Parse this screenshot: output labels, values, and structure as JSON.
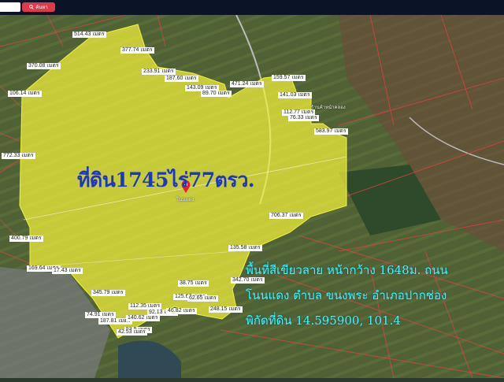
{
  "search": {
    "placeholder": "",
    "button_label": "ค้นหา"
  },
  "main_title": "ที่ดิน1745ไร่77ตรว.",
  "info_lines": [
    "พื้นที่สีเขียวลาย หน้ากว้าง 1648ม. ถนน",
    "โนนแดง ตำบล ขนงพระ อำเภอปากช่อง",
    "พิกัดที่ดิน 14.595900, 101.4"
  ],
  "distance_labels": [
    "514.43 เมตร",
    "377.74 เมตร",
    "370.08 เมตร",
    "233.91 เมตร",
    "187.60 เมตร",
    "143.09 เมตร",
    "89.70 เมตร",
    "471.24 เมตร",
    "159.57 เมตร",
    "106.14 เมตร",
    "141.03 เมตร",
    "112.77 เมตร",
    "76.33 เมตร",
    "583.97 เมตร",
    "772.33 เมตร",
    "706.37 เมตร",
    "400.79 เมตร",
    "135.58 เมตร",
    "169.64 เมตร",
    "17.43 เมตร",
    "342.70 เมตร",
    "345.79 เมตร",
    "38.75 เมตร",
    "125.67 เมตร",
    "62.65 เมตร",
    "112.35 เมตร",
    "248.15 เมตร",
    "74.91 เมตร",
    "187.81 เมตร",
    "92.13 เมตร",
    "140.62 เมตร",
    "46.82 เมตร",
    "53.5 เมตร",
    "42.53 เมตร"
  ],
  "poi_labels": [
    "โนนแดง",
    "ร้านค้าหน้าคลอง"
  ],
  "colors": {
    "parcel_fill": "#f4f23c",
    "title_text": "#1a37c8",
    "info_text": "#49f4f2",
    "boundary_lines": "#e84040",
    "search_button": "#e03a49",
    "marker": "#e0232f"
  }
}
